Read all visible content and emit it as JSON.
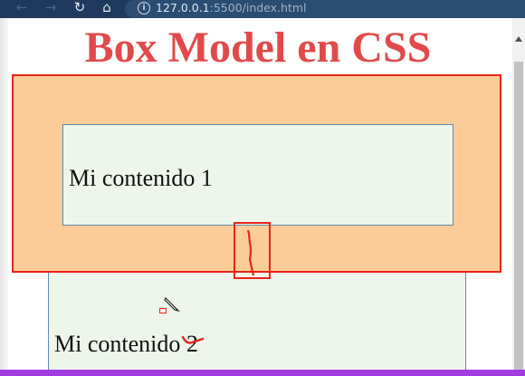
{
  "browser": {
    "nav": {
      "back_icon": "arrow-left-icon",
      "forward_icon": "arrow-right-icon",
      "reload_icon": "reload-icon",
      "home_icon": "home-icon"
    },
    "address_bar": {
      "info_icon": "info-icon",
      "host": "127.0.0.1",
      "path": ":5500/index.html"
    }
  },
  "page": {
    "title": "Box Model en CSS",
    "box1_text": "Mi contenido 1",
    "box2_text": "Mi contenido 2"
  },
  "colors": {
    "title": "#e04a4a",
    "margin_area": "#fccc98",
    "content_bg": "#eef6ec",
    "content_border": "#5f88ad",
    "annotation": "#e8251a",
    "pen_stroke": "#a23ce0",
    "toolbar": "#1f3a5c"
  }
}
